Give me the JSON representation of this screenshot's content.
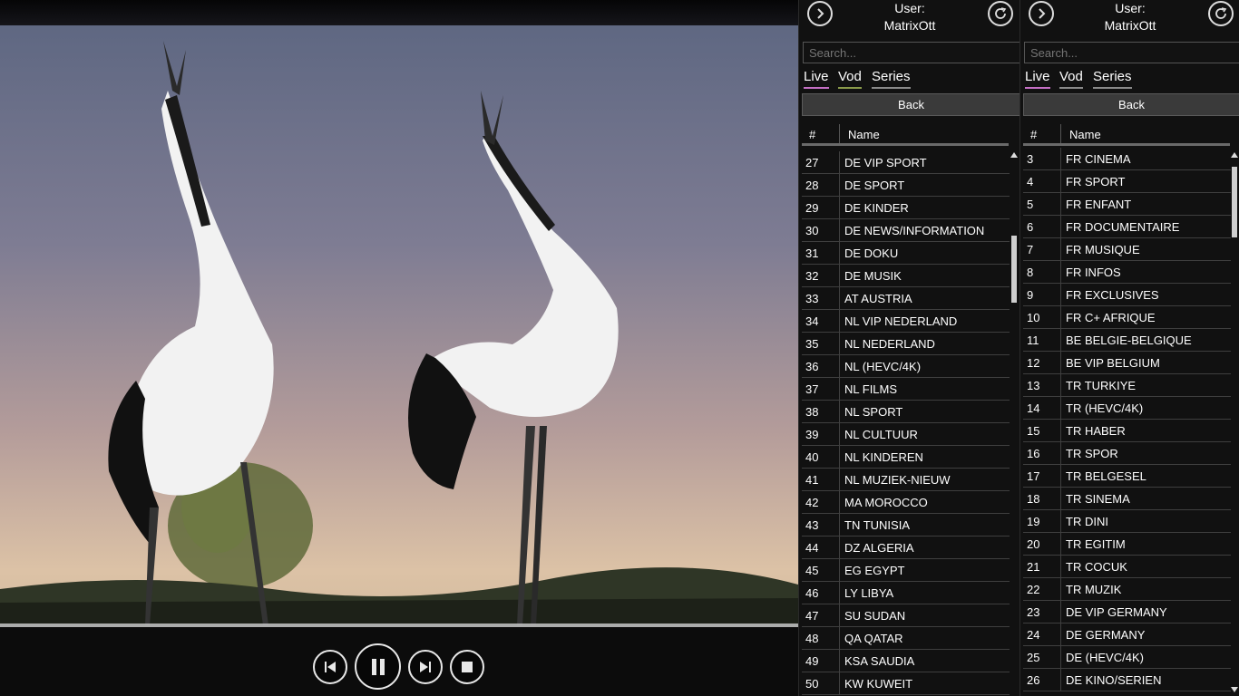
{
  "player": {
    "controls": {
      "previous": "previous-icon",
      "pause": "pause-icon",
      "next": "next-icon",
      "stop": "stop-icon"
    }
  },
  "panels": [
    {
      "user_label": "User:",
      "username": "MatrixOtt",
      "search_placeholder": "Search...",
      "tabs": [
        "Live",
        "Vod",
        "Series"
      ],
      "back_label": "Back",
      "col_num": "#",
      "col_name": "Name",
      "rows": [
        [
          "27",
          "DE VIP SPORT"
        ],
        [
          "28",
          "DE SPORT"
        ],
        [
          "29",
          "DE KINDER"
        ],
        [
          "30",
          "DE NEWS/INFORMATION"
        ],
        [
          "31",
          "DE DOKU"
        ],
        [
          "32",
          "DE MUSIK"
        ],
        [
          "33",
          "AT AUSTRIA"
        ],
        [
          "34",
          "NL VIP NEDERLAND"
        ],
        [
          "35",
          "NL NEDERLAND"
        ],
        [
          "36",
          "NL (HEVC/4K)"
        ],
        [
          "37",
          "NL FILMS"
        ],
        [
          "38",
          "NL SPORT"
        ],
        [
          "39",
          "NL CULTUUR"
        ],
        [
          "40",
          "NL KINDEREN"
        ],
        [
          "41",
          "NL MUZIEK-NIEUW"
        ],
        [
          "42",
          "MA MOROCCO"
        ],
        [
          "43",
          "TN TUNISIA"
        ],
        [
          "44",
          "DZ ALGERIA"
        ],
        [
          "45",
          "EG EGYPT"
        ],
        [
          "46",
          "LY LIBYA"
        ],
        [
          "47",
          "SU SUDAN"
        ],
        [
          "48",
          "QA QATAR"
        ],
        [
          "49",
          "KSA SAUDIA"
        ],
        [
          "50",
          "KW KUWEIT"
        ]
      ]
    },
    {
      "user_label": "User:",
      "username": "MatrixOtt",
      "search_placeholder": "Search...",
      "tabs": [
        "Live",
        "Vod",
        "Series"
      ],
      "back_label": "Back",
      "col_num": "#",
      "col_name": "Name",
      "rows": [
        [
          "3",
          "FR CINEMA"
        ],
        [
          "4",
          "FR SPORT"
        ],
        [
          "5",
          "FR ENFANT"
        ],
        [
          "6",
          "FR DOCUMENTAIRE"
        ],
        [
          "7",
          "FR MUSIQUE"
        ],
        [
          "8",
          "FR INFOS"
        ],
        [
          "9",
          "FR EXCLUSIVES"
        ],
        [
          "10",
          "FR C+ AFRIQUE"
        ],
        [
          "11",
          "BE BELGIE-BELGIQUE"
        ],
        [
          "12",
          "BE VIP BELGIUM"
        ],
        [
          "13",
          "TR TURKIYE"
        ],
        [
          "14",
          "TR (HEVC/4K)"
        ],
        [
          "15",
          "TR HABER"
        ],
        [
          "16",
          "TR SPOR"
        ],
        [
          "17",
          "TR BELGESEL"
        ],
        [
          "18",
          "TR SINEMA"
        ],
        [
          "19",
          "TR DINI"
        ],
        [
          "20",
          "TR EGITIM"
        ],
        [
          "21",
          "TR COCUK"
        ],
        [
          "22",
          "TR MUZIK"
        ],
        [
          "23",
          "DE VIP GERMANY"
        ],
        [
          "24",
          "DE GERMANY"
        ],
        [
          "25",
          "DE (HEVC/4K)"
        ],
        [
          "26",
          "DE KINO/SERIEN"
        ]
      ]
    }
  ],
  "colors": {
    "tab_live_underline": "#c46fc4",
    "tab_vod_underline": "#8a9a4a",
    "tab_series_underline": "#8a8a8a"
  }
}
